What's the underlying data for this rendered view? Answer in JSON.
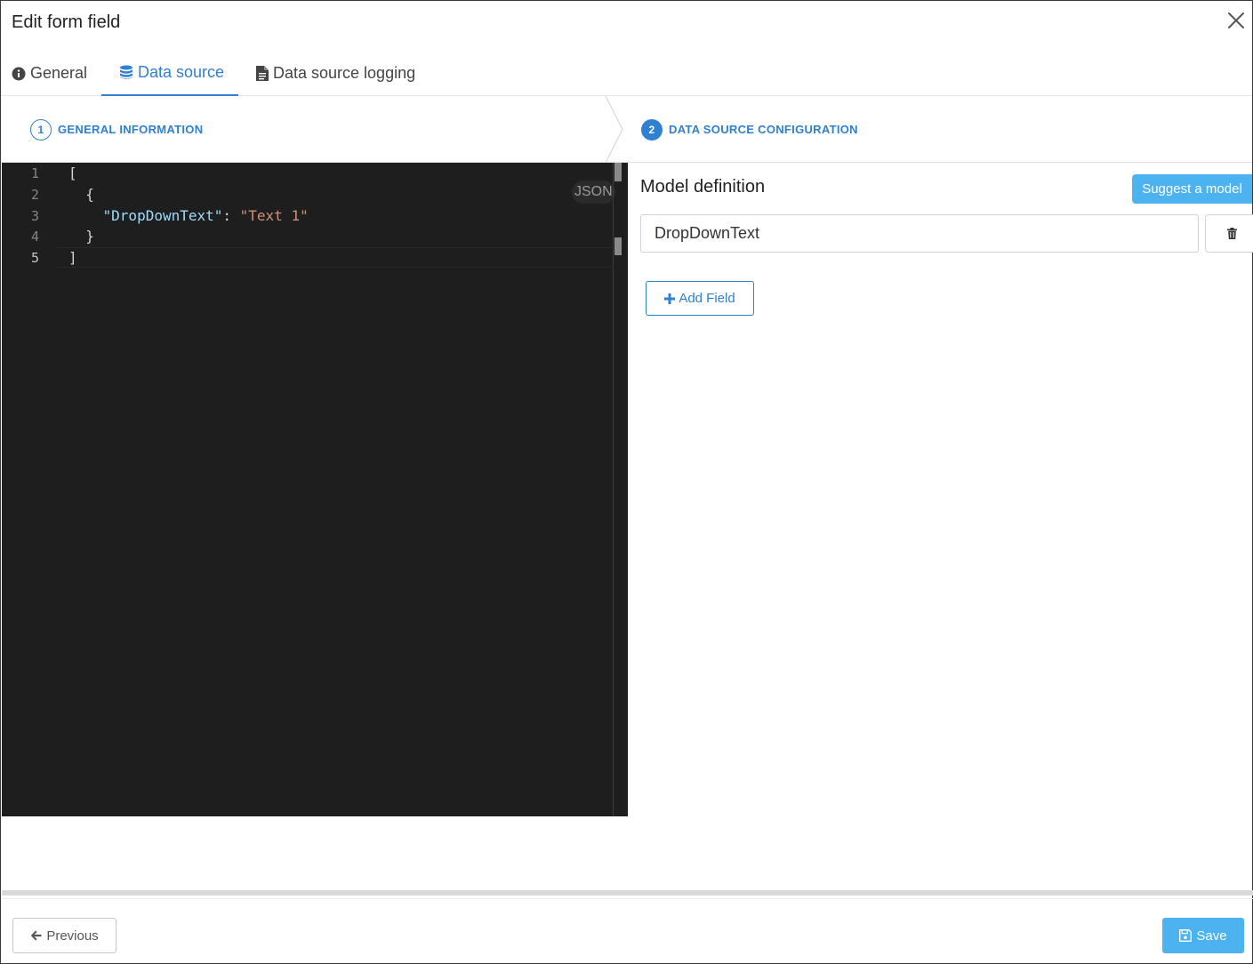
{
  "dialog": {
    "title": "Edit form field",
    "close_icon": "close-icon"
  },
  "tabs": [
    {
      "label": "General",
      "icon": "info-circle-icon",
      "active": false
    },
    {
      "label": "Data source",
      "icon": "database-icon",
      "active": true
    },
    {
      "label": "Data source logging",
      "icon": "file-text-icon",
      "active": false
    }
  ],
  "stepper": {
    "steps": [
      {
        "number": "1",
        "label": "GENERAL INFORMATION",
        "active": false
      },
      {
        "number": "2",
        "label": "DATA SOURCE CONFIGURATION",
        "active": true
      }
    ]
  },
  "editor": {
    "language": "JSON",
    "line_numbers": [
      "1",
      "2",
      "3",
      "4",
      "5"
    ],
    "lines": {
      "l1": "[",
      "l2": "  {",
      "l3_indent": "    ",
      "l3_key": "\"DropDownText\"",
      "l3_colon": ": ",
      "l3_value": "\"Text 1\"",
      "l4": "  }",
      "l5": "]"
    }
  },
  "model": {
    "title": "Model definition",
    "suggest_label": "Suggest a model",
    "fields": [
      {
        "value": "DropDownText"
      }
    ],
    "delete_icon": "trash-icon",
    "add_field_label": "Add Field"
  },
  "footer": {
    "previous_label": "Previous",
    "save_label": "Save"
  },
  "colors": {
    "accent": "#2f80d1",
    "primary_button": "#4db3f0",
    "editor_bg": "#1e1e1e",
    "json_key": "#9cdcfe",
    "json_string": "#ce9178"
  }
}
